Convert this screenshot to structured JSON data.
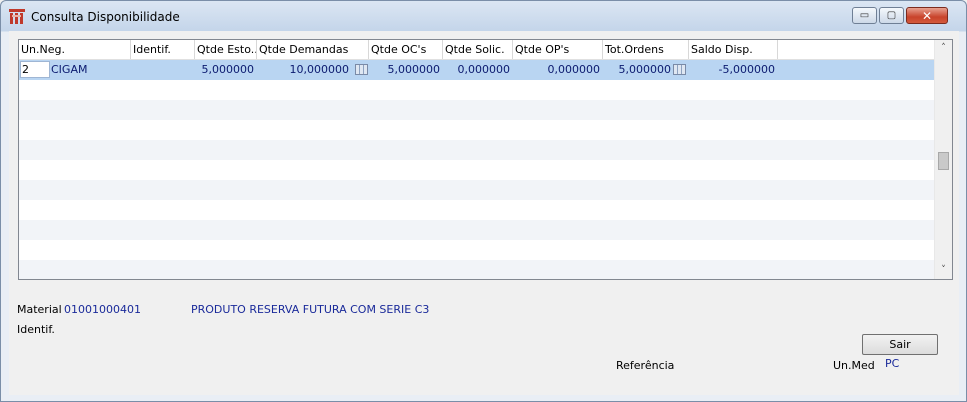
{
  "window": {
    "title": "Consulta Disponibilidade",
    "minimize": "▭",
    "maximize": "▢",
    "close": "✕"
  },
  "grid": {
    "columns": [
      "Un.Neg.",
      "Identif.",
      "Qtde Esto...",
      "Qtde Demandas",
      "Qtde OC's",
      "Qtde Solic.",
      "Qtde OP's",
      "Tot.Ordens",
      "Saldo Disp."
    ],
    "rows": [
      {
        "un_neg": "2",
        "un_neg_name": "CIGAM",
        "identif": "",
        "qtde_estoque": "5,000000",
        "qtde_demandas": "10,000000",
        "qtde_ocs": "5,000000",
        "qtde_solic": "0,000000",
        "qtde_ops": "0,000000",
        "tot_ordens": "5,000000",
        "saldo_disp": "-5,000000"
      }
    ],
    "empty_rows": 10,
    "scroll_up": "˄",
    "scroll_down": "˅"
  },
  "footer": {
    "material_label": "Material",
    "material_code": "01001000401",
    "material_desc": "PRODUTO RESERVA FUTURA COM SERIE C3",
    "identif_label": "Identif.",
    "referencia_label": "Referência",
    "unmed_label": "Un.Med",
    "unmed_value": "PC"
  },
  "buttons": {
    "sair": "Sair"
  }
}
